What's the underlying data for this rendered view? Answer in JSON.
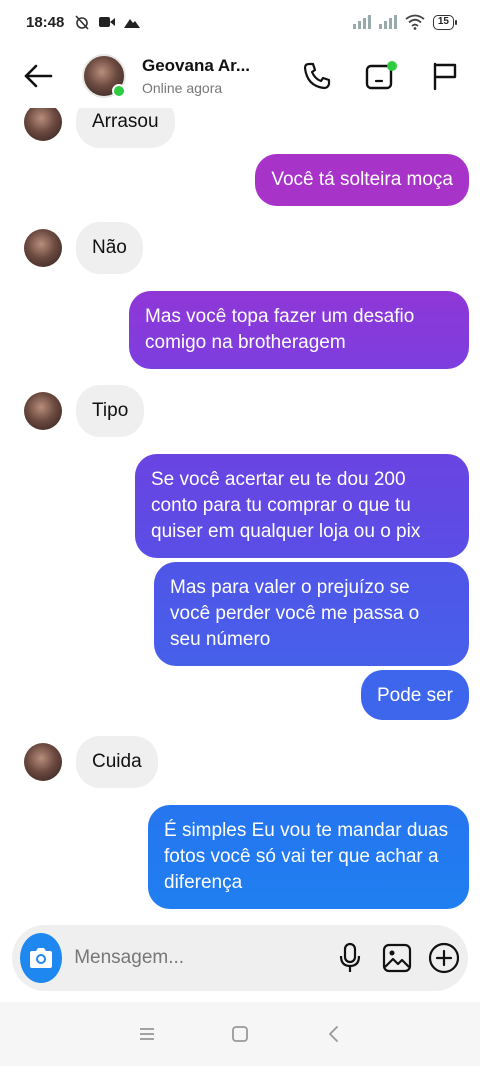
{
  "status_bar": {
    "time": "18:48",
    "battery": "15"
  },
  "header": {
    "contact_name": "Geovana Ar...",
    "contact_status": "Online agora"
  },
  "messages": [
    {
      "side": "in",
      "text": "Arrasou"
    },
    {
      "side": "out",
      "text": "Você tá solteira moça"
    },
    {
      "side": "in",
      "text": "Não"
    },
    {
      "side": "out",
      "text": "Mas você topa fazer um desafio comigo na brotheragem"
    },
    {
      "side": "in",
      "text": "Tipo"
    },
    {
      "side": "out",
      "text": "Se você acertar eu te dou 200 conto para tu comprar o que tu quiser em qualquer loja ou o pix"
    },
    {
      "side": "out",
      "text": "Mas para valer o prejuízo se você perder você me passa o seu número"
    },
    {
      "side": "out",
      "text": "Pode ser"
    },
    {
      "side": "in",
      "text": "Cuida"
    },
    {
      "side": "out",
      "text": "É simples Eu vou te mandar duas fotos você só vai ter que achar a diferença"
    }
  ],
  "composer": {
    "placeholder": "Mensagem..."
  },
  "colors": {
    "accent_blue": "#1e88f0",
    "outgoing_gradient": [
      "#a833c9",
      "#7d3ee0",
      "#4a5ae8",
      "#2b6ef0",
      "#1f7ff0"
    ],
    "incoming_bubble": "#efefef",
    "online": "#2ecc40"
  },
  "icons": {
    "header": [
      "back-arrow-icon",
      "phone-icon",
      "video-call-icon",
      "flag-icon"
    ],
    "composer": [
      "camera-icon",
      "microphone-icon",
      "gallery-icon",
      "plus-circle-icon"
    ],
    "navbar": [
      "menu-icon",
      "home-square-icon",
      "back-chevron-icon"
    ]
  }
}
